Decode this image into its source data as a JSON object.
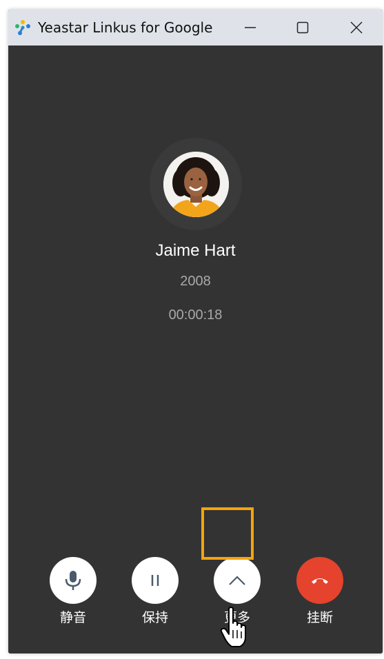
{
  "window": {
    "title": "Yeastar Linkus for Google",
    "minimize_icon": "minimize-icon",
    "maximize_icon": "maximize-icon",
    "close_icon": "close-icon"
  },
  "contact": {
    "name": "Jaime Hart",
    "number": "2008",
    "duration": "00:00:18"
  },
  "controls": [
    {
      "label": "静音",
      "icon": "microphone-icon"
    },
    {
      "label": "保持",
      "icon": "pause-icon"
    },
    {
      "label": "更多",
      "icon": "chevron-up-icon"
    },
    {
      "label": "挂断",
      "icon": "hang-up-icon"
    }
  ],
  "colors": {
    "background": "#333333",
    "titlebar": "#dfe3e9",
    "hangup": "#e5432d",
    "highlight": "#f5a40d",
    "icon": "#4a5a6e"
  }
}
